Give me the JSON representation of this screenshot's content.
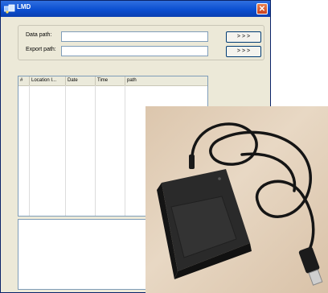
{
  "window": {
    "title": "LMD",
    "close_glyph": "✕",
    "icon": "app-icon"
  },
  "paths": {
    "data_label": "Data path:",
    "data_value": "",
    "data_browse": "> > >",
    "export_label": "Export path:",
    "export_value": "",
    "export_browse": "> > >"
  },
  "table": {
    "columns": [
      "#",
      "Location I...",
      "Date",
      "Time",
      "path"
    ]
  },
  "photo": {
    "subject": "usb-card-reader-photo"
  }
}
